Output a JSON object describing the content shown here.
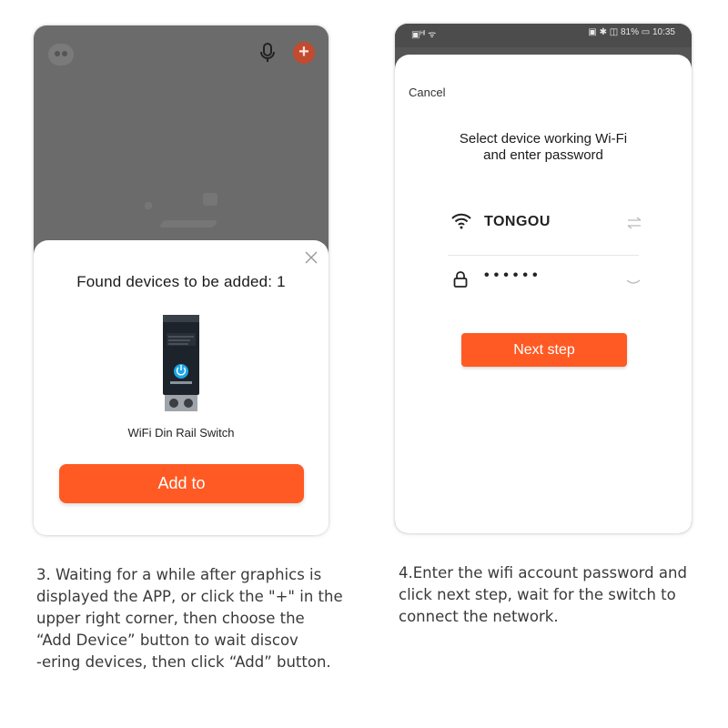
{
  "left_screen": {
    "plus_label": "+",
    "sheet_title": "Found devices to be added: 1",
    "device_name": "WiFi Din Rail Switch",
    "add_button": "Add to",
    "icons": [
      "app-logo-icon",
      "microphone-icon",
      "plus-icon",
      "close-icon",
      "device-image"
    ]
  },
  "right_screen": {
    "status_left": "▣ᴴˡ ᯤ",
    "status_right": "▣ ✱ ◫ 81% ▭ 10:35",
    "cancel": "Cancel",
    "title_line1": "Select device working Wi-Fi",
    "title_line2": "and enter password",
    "ssid": "TONGOU",
    "password_mask": "••••••",
    "next_button": "Next step",
    "icons": [
      "wifi-icon",
      "swap-icon",
      "lock-icon",
      "eye-closed-icon"
    ]
  },
  "captions": {
    "step3": "3. Waiting for a while after graphics is\ndisplayed the APP, or click the \"+\" in the\nupper right corner, then choose the\n  “Add Device” button to wait discov\n-ering devices, then click “Add” button.",
    "step4": "4.Enter the wifi account password and\nclick next step, wait for the switch to\nconnect the network."
  },
  "colors": {
    "accent": "#ff5a23",
    "overlay": "#6b6b6b",
    "plus_button": "#c24a2e",
    "status_bar": "#4c4c4c"
  }
}
